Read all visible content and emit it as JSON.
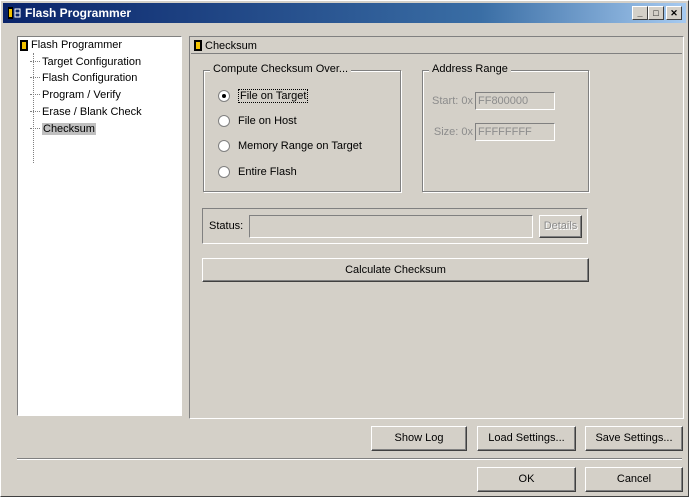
{
  "window": {
    "title": "Flash Programmer"
  },
  "tree": {
    "root": "Flash Programmer",
    "items": [
      {
        "label": "Target Configuration"
      },
      {
        "label": "Flash Configuration"
      },
      {
        "label": "Program / Verify"
      },
      {
        "label": "Erase / Blank Check"
      },
      {
        "label": "Checksum",
        "selected": true
      }
    ]
  },
  "panel": {
    "header": "Checksum",
    "compute": {
      "legend": "Compute Checksum Over...",
      "options": [
        {
          "label": "File on Target",
          "checked": true
        },
        {
          "label": "File on Host",
          "checked": false
        },
        {
          "label": "Memory Range on Target",
          "checked": false
        },
        {
          "label": "Entire Flash",
          "checked": false
        }
      ]
    },
    "address_range": {
      "legend": "Address Range",
      "start_label": "Start: 0x",
      "start_value": "FF800000",
      "size_label": "Size: 0x",
      "size_value": "FFFFFFFF"
    },
    "status": {
      "label": "Status:",
      "value": "",
      "details_label": "Details"
    },
    "calculate_label": "Calculate Checksum"
  },
  "footer": {
    "show_log": "Show Log",
    "load_settings": "Load Settings...",
    "save_settings": "Save Settings...",
    "ok": "OK",
    "cancel": "Cancel"
  }
}
